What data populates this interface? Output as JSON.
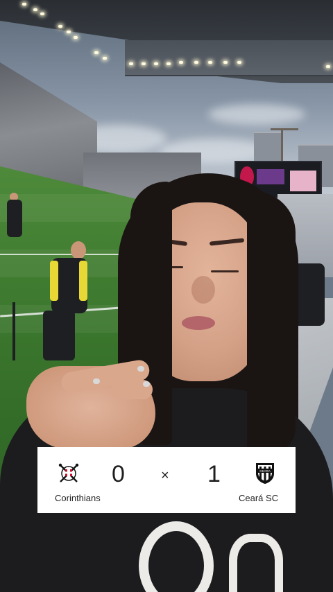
{
  "scoreboard": {
    "home": {
      "name": "Corinthians",
      "score": "0",
      "crest_icon": "corinthians-crest-icon"
    },
    "separator": "×",
    "away": {
      "name": "Ceará SC",
      "score": "1",
      "crest_icon": "ceara-crest-icon"
    },
    "colors": {
      "card_background": "#ffffff",
      "text": "#1f1f1f",
      "home_crest_red": "#c8102e",
      "away_crest_black": "#111111"
    }
  }
}
